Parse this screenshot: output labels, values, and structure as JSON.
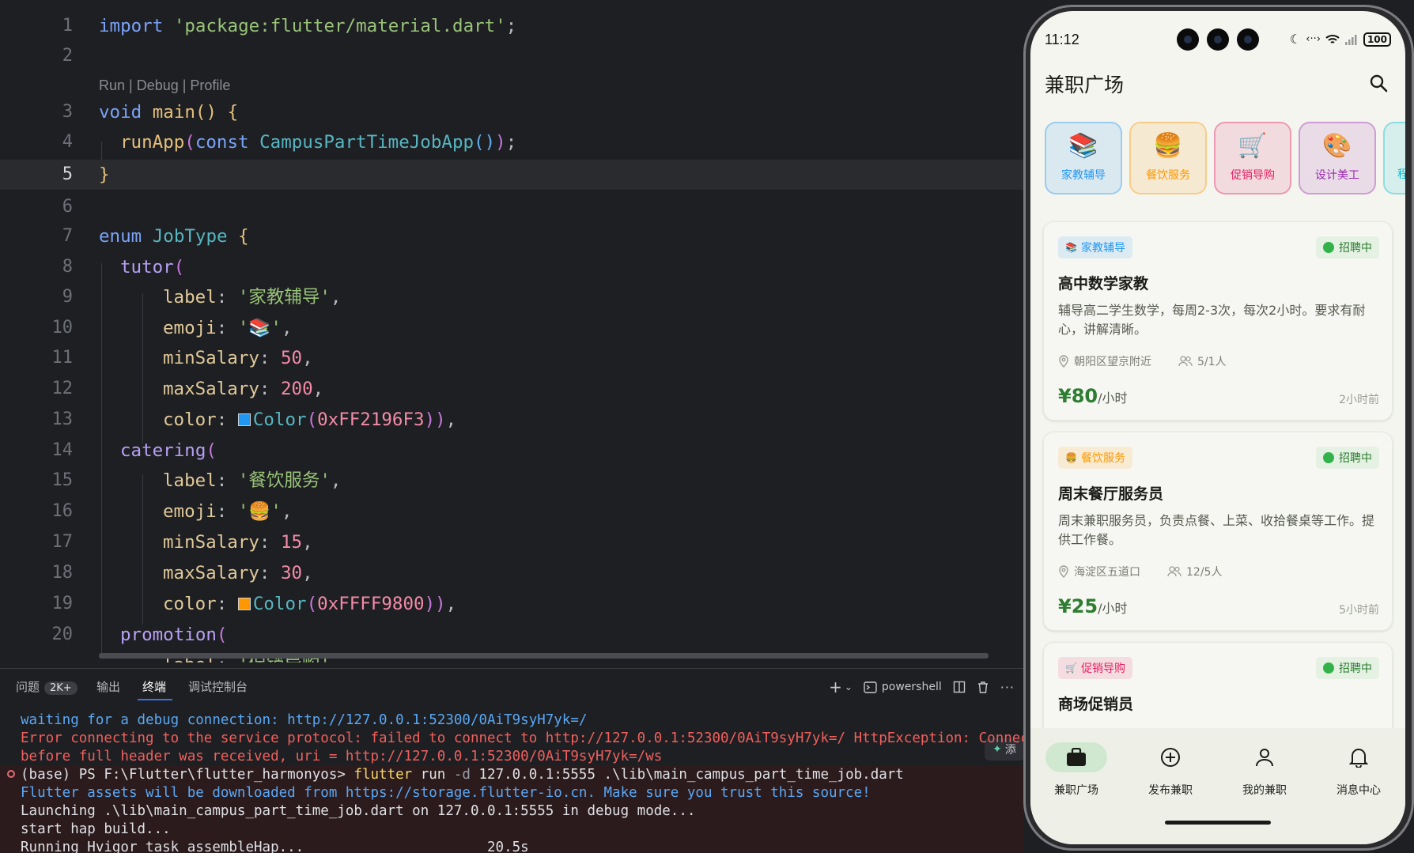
{
  "editor": {
    "codelens": "Run | Debug | Profile",
    "line_numbers": [
      "1",
      "2",
      "3",
      "4",
      "5",
      "6",
      "7",
      "8",
      "9",
      "10",
      "11",
      "12",
      "13",
      "14",
      "15",
      "16",
      "17",
      "18",
      "19",
      "20"
    ],
    "lines": {
      "l1": {
        "a": "import",
        "b": " ",
        "c": "'package:flutter/material.dart'",
        "d": ";"
      },
      "l3": {
        "a": "void",
        "b": " ",
        "c": "main",
        "d": "()",
        "e": " ",
        "f": "{"
      },
      "l4": {
        "a": "runApp",
        "b": "(",
        "c": "const",
        "d": " ",
        "e": "CampusPartTimeJobApp",
        "f": "()",
        "g": ")",
        "h": ";"
      },
      "l5": {
        "a": "}"
      },
      "l7": {
        "a": "enum",
        "b": " JobType ",
        "c": "{"
      },
      "l8": {
        "a": "tutor",
        "b": "("
      },
      "l9": {
        "a": "label",
        "b": ": ",
        "c": "'家教辅导'",
        "d": ","
      },
      "l10": {
        "a": "emoji",
        "b": ": ",
        "c": "'📚'",
        "d": ","
      },
      "l11": {
        "a": "minSalary",
        "b": ": ",
        "c": "50",
        "d": ","
      },
      "l12": {
        "a": "maxSalary",
        "b": ": ",
        "c": "200",
        "d": ","
      },
      "l13": {
        "a": "color",
        "b": ": ",
        "c": "Color",
        "d": "(",
        "e": "0xFF2196F3",
        "f": ")",
        "g": ")",
        "h": ","
      },
      "l14": {
        "a": "catering",
        "b": "("
      },
      "l15": {
        "a": "label",
        "b": ": ",
        "c": "'餐饮服务'",
        "d": ","
      },
      "l16": {
        "a": "emoji",
        "b": ": ",
        "c": "'🍔'",
        "d": ","
      },
      "l17": {
        "a": "minSalary",
        "b": ": ",
        "c": "15",
        "d": ","
      },
      "l18": {
        "a": "maxSalary",
        "b": ": ",
        "c": "30",
        "d": ","
      },
      "l19": {
        "a": "color",
        "b": ": ",
        "c": "Color",
        "d": "(",
        "e": "0xFFFF9800",
        "f": ")",
        "g": ")",
        "h": ","
      },
      "l20": {
        "a": "promotion",
        "b": "("
      },
      "l21": {
        "a": "label",
        "b": ": ",
        "c": "'促销导购'"
      }
    },
    "swatch_colors": {
      "tutor": "#2196F3",
      "catering": "#FF9800"
    }
  },
  "panel": {
    "tabs": {
      "problems": "问题",
      "problems_badge": "2K+",
      "output": "输出",
      "terminal": "终端",
      "debug_console": "调试控制台"
    },
    "tools": {
      "add": "+",
      "chevron": "⌄",
      "shell": "powershell",
      "more": "···"
    },
    "ai_button": "添",
    "terminal": {
      "l1": "waiting for a debug connection: http://127.0.0.1:52300/0AiT9syH7yk=/",
      "l2": "Error connecting to the service protocol: failed to connect to http://127.0.0.1:52300/0AiT9syH7yk=/ HttpException: Connect",
      "l3": "before full header was received, uri = http://127.0.0.1:52300/0AiT9syH7yk=/ws",
      "l4_prompt": "(base) PS F:\\Flutter\\flutter_harmonyos> ",
      "l4_cmd": "flutter",
      "l4_run": " run ",
      "l4_flag": "-d",
      "l4_rest": " 127.0.0.1:5555 .\\lib\\main_campus_part_time_job.dart",
      "l5": "Flutter assets will be downloaded from https://storage.flutter-io.cn. Make sure you trust this source!",
      "l6": "Launching .\\lib\\main_campus_part_time_job.dart on 127.0.0.1:5555 in debug mode...",
      "l7": "start hap build...",
      "l8": "Running Hvigor task assembleHap...                      20.5s"
    }
  },
  "phone": {
    "status": {
      "time": "11:12",
      "battery": "100"
    },
    "title": "兼职广场",
    "categories": [
      {
        "emoji": "📚",
        "label": "家教辅导",
        "color": "#2196F3"
      },
      {
        "emoji": "🍔",
        "label": "餐饮服务",
        "color": "#FF9800"
      },
      {
        "emoji": "🛒",
        "label": "促销导购",
        "color": "#E91E63"
      },
      {
        "emoji": "🎨",
        "label": "设计美工",
        "color": "#9C27B0"
      },
      {
        "emoji": "",
        "label": "程",
        "color": "#00BCD4"
      }
    ],
    "jobs": [
      {
        "tag_emoji": "📚",
        "tag": "家教辅导",
        "status": "招聘中",
        "title": "高中数学家教",
        "desc": "辅导高二学生数学，每周2-3次，每次2小时。要求有耐心，讲解清晰。",
        "location": "朝阳区望京附近",
        "people": "5/1人",
        "price": "¥80",
        "unit": "/小时",
        "time": "2小时前"
      },
      {
        "tag_emoji": "🍔",
        "tag": "餐饮服务",
        "status": "招聘中",
        "title": "周末餐厅服务员",
        "desc": "周末兼职服务员，负责点餐、上菜、收拾餐桌等工作。提供工作餐。",
        "location": "海淀区五道口",
        "people": "12/5人",
        "price": "¥25",
        "unit": "/小时",
        "time": "5小时前"
      },
      {
        "tag_emoji": "🛒",
        "tag": "促销导购",
        "status": "招聘中",
        "title": "商场促销员"
      }
    ],
    "nav": [
      {
        "label": "兼职广场",
        "icon": "briefcase-icon",
        "active": true
      },
      {
        "label": "发布兼职",
        "icon": "add-circle-icon",
        "active": false
      },
      {
        "label": "我的兼职",
        "icon": "person-icon",
        "active": false
      },
      {
        "label": "消息中心",
        "icon": "bell-icon",
        "active": false
      }
    ]
  }
}
